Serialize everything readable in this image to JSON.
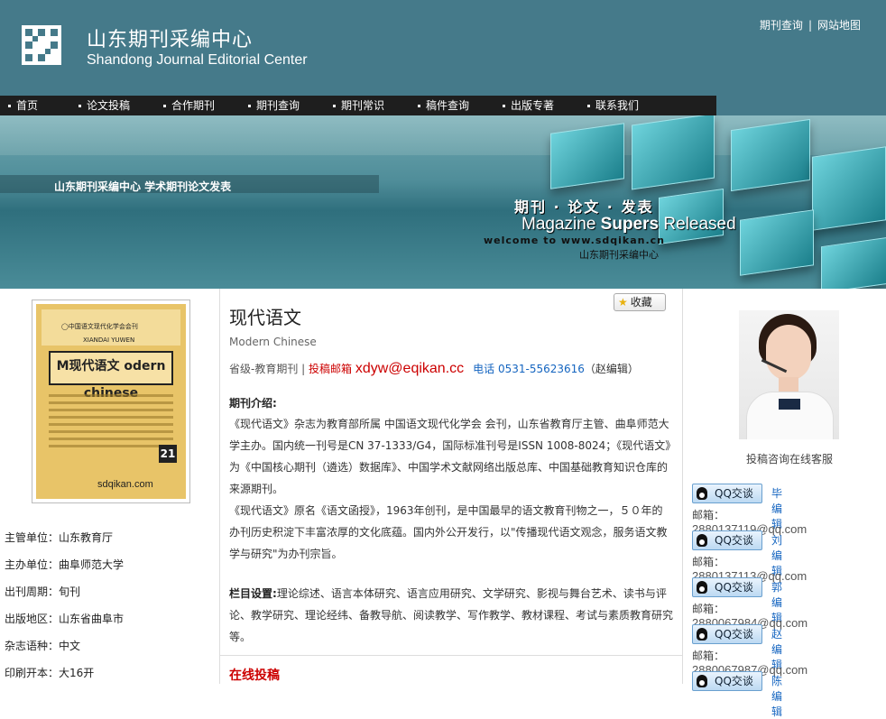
{
  "header": {
    "title_cn": "山东期刊采编中心",
    "title_en": "Shandong Journal Editorial Center",
    "top_links": [
      "期刊查询",
      "网站地图"
    ],
    "top_sep": "|"
  },
  "nav": {
    "items": [
      "首页",
      "论文投稿",
      "合作期刊",
      "期刊查询",
      "期刊常识",
      "稿件查询",
      "出版专著",
      "联系我们"
    ]
  },
  "banner": {
    "tagline": "山东期刊采编中心   学术期刊论文发表",
    "cn": "期刊 · 论文 · 发表",
    "en_pre": "Magazine ",
    "en_bold": "Supers",
    "en_post": " Released",
    "welcome": "welcome to www.sdqikan.cn",
    "center": "山东期刊采编中心"
  },
  "cover": {
    "small1": "◯中国语文现代化学会会刊",
    "small2": "XIANDAI YUWEN",
    "title": "M现代语文 odern chinese",
    "site": "sdqikan.com",
    "num": "21"
  },
  "info": [
    {
      "label": "主管单位：",
      "value": "山东教育厅"
    },
    {
      "label": "主办单位：",
      "value": "曲阜师范大学"
    },
    {
      "label": "出刊周期：",
      "value": "旬刊"
    },
    {
      "label": "出版地区：",
      "value": "山东省曲阜市"
    },
    {
      "label": "杂志语种：",
      "value": "中文"
    },
    {
      "label": "印刷开本：",
      "value": "大16开"
    }
  ],
  "journal": {
    "favorite": "收藏",
    "title": "现代语文",
    "title_en": "Modern Chinese",
    "level": "省级-教育期刊 | ",
    "submit_label": "投稿邮箱 ",
    "email": "xdyw@eqikan.cc",
    "tel_label": "电话 ",
    "tel": "0531-55623616",
    "editor": "（赵编辑）",
    "intro_heading": "期刊介绍:",
    "intro_p1": "《现代语文》杂志为教育部所属 中国语文现代化学会 会刊，山东省教育厅主管、曲阜师范大学主办。国内统一刊号是CN 37-1333/G4，国际标准刊号是ISSN 1008-8024；《现代语文》为《中国核心期刊（遴选）数据库》、中国学术文献网络出版总库、中国基础教育知识仓库的来源期刊。",
    "intro_p2": "《现代语文》原名《语文函授》，1963年创刊，是中国最早的语文教育刊物之一，５０年的办刊历史积淀下丰富浓厚的文化底蕴。国内外公开发行，以\"传播现代语文观念，服务语文教学与研究\"为办刊宗旨。",
    "columns_label": "栏目设置:",
    "columns_text": "理论综述、语言本体研究、语言应用研究、文学研究、影视与舞台艺术、读书与评论、教学研究、理论经纬、备教导航、阅读教学、写作教学、教材课程、考试与素质教育研究等。",
    "online_heading": "在线投稿"
  },
  "support": {
    "label": "投稿咨询在线客服",
    "qq_label": "QQ交谈",
    "mail_label": "邮箱：",
    "agents": [
      {
        "name": "毕编辑",
        "email": "2880137119@qq.com"
      },
      {
        "name": "刘编辑",
        "email": "2880137113@qq.com"
      },
      {
        "name": "郭编辑",
        "email": "2880067984@qq.com"
      },
      {
        "name": "赵编辑",
        "email": "2880067987@qq.com"
      },
      {
        "name": "陈编辑",
        "email": ""
      }
    ]
  }
}
